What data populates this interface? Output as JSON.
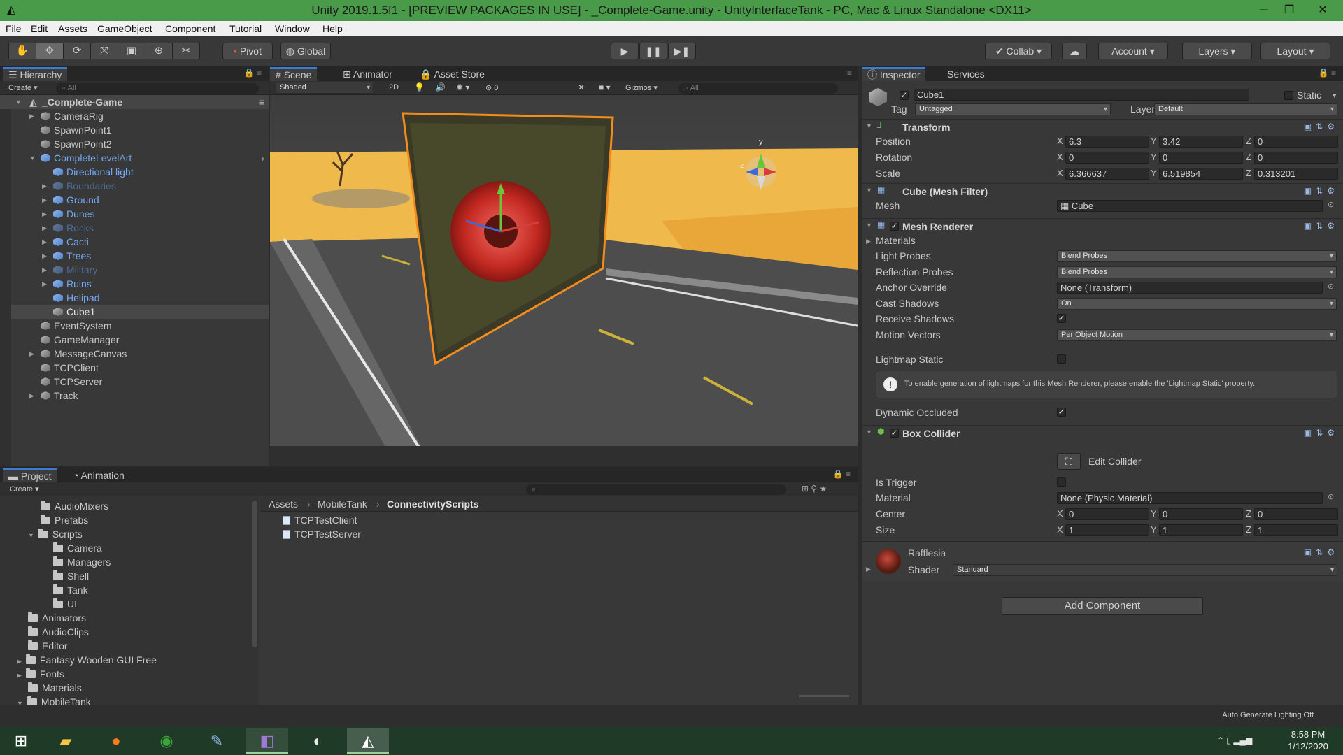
{
  "window": {
    "title": "Unity 2019.1.5f1 - [PREVIEW PACKAGES IN USE] - _Complete-Game.unity - UnityInterfaceTank - PC, Mac & Linux Standalone <DX11>"
  },
  "menu": [
    "File",
    "Edit",
    "Assets",
    "GameObject",
    "Component",
    "Tutorial",
    "Window",
    "Help"
  ],
  "toolbar": {
    "pivot": "Pivot",
    "global": "Global",
    "collab": "Collab",
    "account": "Account",
    "layers": "Layers",
    "layout": "Layout"
  },
  "hierarchy": {
    "tab": "Hierarchy",
    "create": "Create",
    "search_placeholder": "All",
    "scene": "_Complete-Game",
    "items": [
      {
        "label": "CameraRig"
      },
      {
        "label": "SpawnPoint1"
      },
      {
        "label": "SpawnPoint2"
      },
      {
        "label": "CompleteLevelArt"
      },
      {
        "label": "Directional light"
      },
      {
        "label": "Boundaries"
      },
      {
        "label": "Ground"
      },
      {
        "label": "Dunes"
      },
      {
        "label": "Rocks"
      },
      {
        "label": "Cacti"
      },
      {
        "label": "Trees"
      },
      {
        "label": "Military"
      },
      {
        "label": "Ruins"
      },
      {
        "label": "Helipad"
      },
      {
        "label": "Cube1"
      },
      {
        "label": "EventSystem"
      },
      {
        "label": "GameManager"
      },
      {
        "label": "MessageCanvas"
      },
      {
        "label": "TCPClient"
      },
      {
        "label": "TCPServer"
      },
      {
        "label": "Track"
      }
    ]
  },
  "scene": {
    "tabs": [
      "Scene",
      "Animator",
      "Asset Store"
    ],
    "shading": "Shaded",
    "mode_2d": "2D",
    "hidden_count": "0",
    "gizmos": "Gizmos",
    "search_placeholder": "All",
    "axis_y": "y",
    "axis_z": "z"
  },
  "project": {
    "tabs": [
      "Project",
      "Animation"
    ],
    "create": "Create",
    "tree": [
      {
        "label": "AudioMixers"
      },
      {
        "label": "Prefabs"
      },
      {
        "label": "Scripts"
      },
      {
        "label": "Camera"
      },
      {
        "label": "Managers"
      },
      {
        "label": "Shell"
      },
      {
        "label": "Tank"
      },
      {
        "label": "UI"
      },
      {
        "label": "Animators"
      },
      {
        "label": "AudioClips"
      },
      {
        "label": "Editor"
      },
      {
        "label": "Fantasy Wooden GUI  Free"
      },
      {
        "label": "Fonts"
      },
      {
        "label": "Materials"
      },
      {
        "label": "MobileTank"
      }
    ],
    "breadcrumb": [
      "Assets",
      "MobileTank",
      "ConnectivityScripts"
    ],
    "files": [
      "TCPTestClient",
      "TCPTestServer"
    ]
  },
  "inspector": {
    "tabs": [
      "Inspector",
      "Services"
    ],
    "object_name": "Cube1",
    "static_label": "Static",
    "tag_label": "Tag",
    "tag_value": "Untagged",
    "layer_label": "Layer",
    "layer_value": "Default",
    "transform": {
      "title": "Transform",
      "position_label": "Position",
      "rotation_label": "Rotation",
      "scale_label": "Scale",
      "position": {
        "x": "6.3",
        "y": "3.42",
        "z": "0"
      },
      "rotation": {
        "x": "0",
        "y": "0",
        "z": "0"
      },
      "scale": {
        "x": "6.366637",
        "y": "6.519854",
        "z": "0.313201"
      }
    },
    "mesh_filter": {
      "title": "Cube (Mesh Filter)",
      "mesh_label": "Mesh",
      "mesh_value": "Cube"
    },
    "mesh_renderer": {
      "title": "Mesh Renderer",
      "materials_label": "Materials",
      "light_probes_label": "Light Probes",
      "light_probes_value": "Blend Probes",
      "reflection_probes_label": "Reflection Probes",
      "reflection_probes_value": "Blend Probes",
      "anchor_override_label": "Anchor Override",
      "anchor_override_value": "None (Transform)",
      "cast_shadows_label": "Cast Shadows",
      "cast_shadows_value": "On",
      "receive_shadows_label": "Receive Shadows",
      "motion_vectors_label": "Motion Vectors",
      "motion_vectors_value": "Per Object Motion",
      "lightmap_static_label": "Lightmap Static",
      "info_text": "To enable generation of lightmaps for this Mesh Renderer, please enable the 'Lightmap Static' property.",
      "dynamic_occluded_label": "Dynamic Occluded"
    },
    "box_collider": {
      "title": "Box Collider",
      "edit_collider": "Edit Collider",
      "is_trigger_label": "Is Trigger",
      "material_label": "Material",
      "material_value": "None (Physic Material)",
      "center_label": "Center",
      "size_label": "Size",
      "center": {
        "x": "0",
        "y": "0",
        "z": "0"
      },
      "size": {
        "x": "1",
        "y": "1",
        "z": "1"
      }
    },
    "material": {
      "name": "Rafflesia",
      "shader_label": "Shader",
      "shader_value": "Standard"
    },
    "add_component": "Add Component"
  },
  "status": {
    "text": "Auto Generate Lighting Off"
  },
  "taskbar": {
    "time": "8:58 PM",
    "date": "1/12/2020"
  },
  "colors": {
    "title_bar": "#4a9b49",
    "selection_blue": "#3d7bd6",
    "taskbar": "#1f3a26"
  }
}
